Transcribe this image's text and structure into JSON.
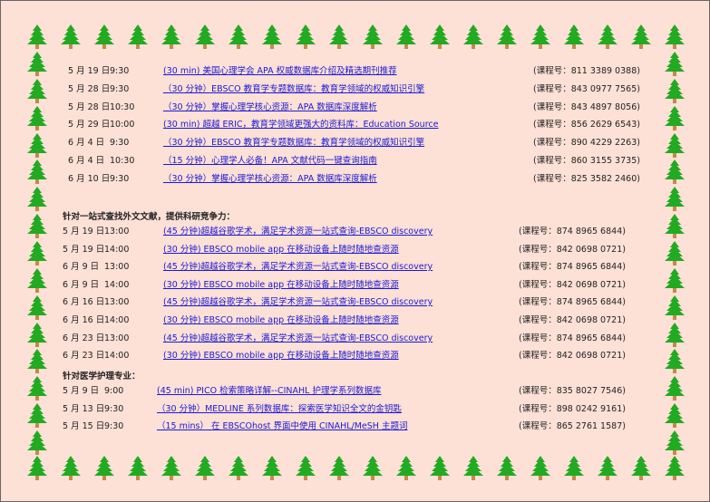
{
  "sections": [
    {
      "heading": "",
      "rows": [
        {
          "date": "5 月 19 日",
          "time": "9:30",
          "title": "(30 min) 美国心理学会 APA 权威数据库介绍及精选期刊推荐",
          "code": "(课程号：811 3389 0388)"
        },
        {
          "date": "5 月 28 日",
          "time": "9:30",
          "title": "（30 分钟）EBSCO 教育学专题数据库：教育学领域的权威知识引擎",
          "code": "(课程号：843 0977 7565)"
        },
        {
          "date": "5 月 28 日",
          "time": "10:30",
          "title": "（30 分钟）掌握心理学核心资源：APA 数据库深度解析",
          "code": "(课程号：843 4897 8056)"
        },
        {
          "date": "5 月 29 日",
          "time": "10:00",
          "title": "(30 min) 超越 ERIC，教育学领域更强大的资料库：Education Source",
          "code": "(课程号：856 2629 6543)"
        },
        {
          "date": "6 月 4 日",
          "time": "9:30",
          "title": "（30 分钟）EBSCO 教育学专题数据库：教育学领域的权威知识引擎",
          "code": "(课程号：890 4229 2263)"
        },
        {
          "date": "6 月 4 日",
          "time": "10:30",
          "title": "（15 分钟）心理学人必备！APA 文献代码一键查询指南",
          "code": "(课程号：860 3155 3735)"
        },
        {
          "date": "6 月 10 日",
          "time": "9:30",
          "title": "（30 分钟）掌握心理学核心资源：APA 数据库深度解析",
          "code": "(课程号：825 3582 2460)"
        }
      ]
    },
    {
      "heading": "针对一站式查找外文文献，提供科研竞争力：",
      "rows": [
        {
          "date": "5 月 19 日",
          "time": "13:00",
          "title": "(45 分钟)超越谷歌学术，满足学术资源一站式查询-EBSCO discovery",
          "code": "(课程号：874 8965 6844)"
        },
        {
          "date": "5 月 19 日",
          "time": "14:00",
          "title": "(30 分钟) EBSCO mobile app 在移动设备上随时随地查资源",
          "code": "(课程号：842 0698 0721)"
        },
        {
          "date": "6 月 9 日",
          "time": "13:00",
          "title": "(45 分钟)超越谷歌学术，满足学术资源一站式查询-EBSCO discovery",
          "code": "(课程号：874 8965 6844)"
        },
        {
          "date": "6 月 9 日",
          "time": "14:00",
          "title": "(30 分钟) EBSCO mobile app 在移动设备上随时随地查资源",
          "code": "(课程号：842 0698 0721)"
        },
        {
          "date": "6 月 16 日",
          "time": "13:00",
          "title": "(45 分钟)超越谷歌学术，满足学术资源一站式查询-EBSCO discovery",
          "code": "(课程号：874 8965 6844)"
        },
        {
          "date": "6 月 16 日",
          "time": "14:00",
          "title": "(30 分钟) EBSCO mobile app 在移动设备上随时随地查资源",
          "code": "(课程号：842 0698 0721)"
        },
        {
          "date": "6 月 23 日",
          "time": "13:00",
          "title": "(45 分钟)超越谷歌学术，满足学术资源一站式查询-EBSCO discovery",
          "code": "(课程号：874 8965 6844)"
        },
        {
          "date": "6 月 23 日",
          "time": "14:00",
          "title": "(30 分钟) EBSCO mobile app 在移动设备上随时随地查资源",
          "code": "(课程号：842 0698 0721)"
        }
      ]
    },
    {
      "heading": "针对医学护理专业：",
      "rows": [
        {
          "date": "5 月 9 日",
          "time": "9:00",
          "title": "(45 min) PICO 检索策略详解--CINAHL 护理学系列数据库",
          "code": "(课程号：835 8027 7546)"
        },
        {
          "date": "5 月 13 日",
          "time": "9:30",
          "title": "（30 分钟）MEDLINE 系列数据库：探索医学知识全文的金钥匙",
          "code": "(课程号：898 0242 9161)"
        },
        {
          "date": "5 月 15 日",
          "time": "9:30",
          "title": "（15 mins） 在 EBSCOhost 界面中使用 CINAHL/MeSH 主题词",
          "code": "(课程号：865 2761 1587)"
        }
      ]
    }
  ],
  "colors": {
    "background": "#fde0d6",
    "link": "#1a1ad6",
    "tree_green": "#22aa22",
    "tree_trunk": "#c58a4a"
  },
  "border_icon": "christmas-tree-icon"
}
